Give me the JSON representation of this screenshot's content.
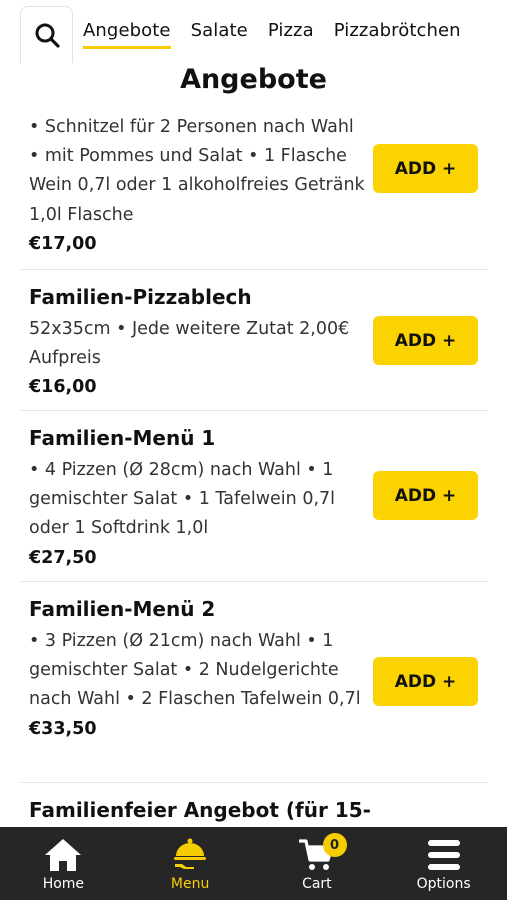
{
  "tabs": [
    {
      "label": "Angebote",
      "active": true
    },
    {
      "label": "Salate",
      "active": false
    },
    {
      "label": "Pizza",
      "active": false
    },
    {
      "label": "Pizzabrötchen",
      "active": false
    }
  ],
  "section_title": "Angebote",
  "add_label": "ADD +",
  "items": [
    {
      "name": "",
      "desc": "• Schnitzel für 2 Personen nach Wahl • mit Pommes und Salat • 1 Flasche Wein 0,7l oder 1 alkoholfreies Getränk 1,0l Flasche",
      "price": "€17,00"
    },
    {
      "name": "Familien-Pizzablech",
      "desc": "52x35cm • Jede weitere Zutat 2,00€ Aufpreis",
      "price": "€16,00"
    },
    {
      "name": "Familien-Menü 1",
      "desc": "• 4 Pizzen (Ø 28cm) nach Wahl • 1 gemischter Salat • 1 Tafelwein 0,7l oder 1 Softdrink 1,0l",
      "price": "€27,50"
    },
    {
      "name": "Familien-Menü 2",
      "desc": "• 3 Pizzen (Ø 21cm) nach Wahl • 1 gemischter Salat • 2 Nudelgerichte nach Wahl • 2 Flaschen Tafelwein 0,7l",
      "price": "€33,50"
    },
    {
      "name": "Familienfeier Angebot (für 15-",
      "desc": "",
      "price": ""
    }
  ],
  "nav": {
    "home": "Home",
    "menu": "Menu",
    "cart": "Cart",
    "cart_count": "0",
    "options": "Options"
  },
  "colors": {
    "accent": "#fbd300",
    "nav_bg": "#262626"
  },
  "icons": [
    "search-icon",
    "home-icon",
    "menu-cloche-icon",
    "cart-icon",
    "hamburger-icon"
  ]
}
